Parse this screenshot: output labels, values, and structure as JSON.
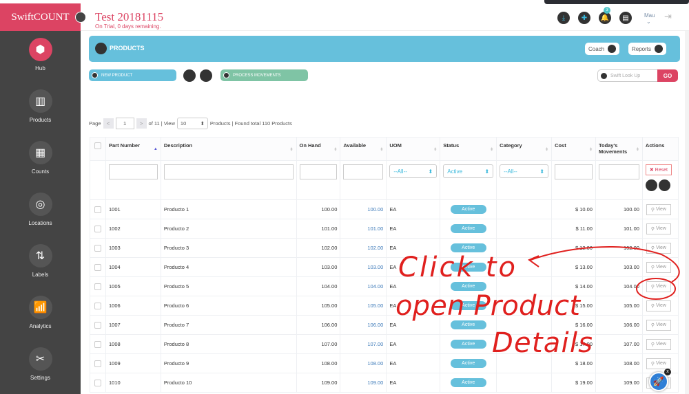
{
  "brand": "SwiftCOUNT",
  "header": {
    "title": "Test 20181115",
    "subtitle": "On Trial, 0 days remaining.",
    "notification_count": "3",
    "user": "Mau"
  },
  "sidebar": [
    {
      "label": "Hub",
      "icon": "hub-icon"
    },
    {
      "label": "Products",
      "icon": "barcode-icon"
    },
    {
      "label": "Counts",
      "icon": "counts-icon"
    },
    {
      "label": "Locations",
      "icon": "location-icon"
    },
    {
      "label": "Labels",
      "icon": "labels-icon"
    },
    {
      "label": "Analytics",
      "icon": "analytics-icon"
    },
    {
      "label": "Settings",
      "icon": "settings-icon"
    }
  ],
  "banner": {
    "title": "PRODUCTS",
    "coach": "Coach",
    "reports": "Reports"
  },
  "toolbar": {
    "new_product": "NEW PRODUCT",
    "process_movements": "PROCESS MOVEMENTS",
    "lookup_placeholder": "Swift Look Up",
    "go": "GO"
  },
  "pager": {
    "page_label": "Page",
    "prev": "<",
    "page": "1",
    "next": ">",
    "of_text": "of 11 | View",
    "per_page": "10",
    "summary": "Products | Found total 110 Products"
  },
  "columns": [
    "Part Number",
    "Description",
    "On Hand",
    "Available",
    "UOM",
    "Status",
    "Category",
    "Cost",
    "Today's Movements",
    "Actions"
  ],
  "filters": {
    "uom": "--All--",
    "status": "Active",
    "category": "--All--",
    "reset": "✖ Reset"
  },
  "rows": [
    [
      "1001",
      "Producto 1",
      "100.00",
      "100.00",
      "EA",
      "Active",
      "",
      "$ 10.00",
      "100.00"
    ],
    [
      "1002",
      "Producto 2",
      "101.00",
      "101.00",
      "EA",
      "Active",
      "",
      "$ 11.00",
      "101.00"
    ],
    [
      "1003",
      "Producto 3",
      "102.00",
      "102.00",
      "EA",
      "Active",
      "",
      "$ 12.00",
      "102.00"
    ],
    [
      "1004",
      "Producto 4",
      "103.00",
      "103.00",
      "EA",
      "Active",
      "",
      "$ 13.00",
      "103.00"
    ],
    [
      "1005",
      "Producto 5",
      "104.00",
      "104.00",
      "EA",
      "Active",
      "",
      "$ 14.00",
      "104.00"
    ],
    [
      "1006",
      "Producto 6",
      "105.00",
      "105.00",
      "EA",
      "Active",
      "",
      "$ 15.00",
      "105.00"
    ],
    [
      "1007",
      "Producto 7",
      "106.00",
      "106.00",
      "EA",
      "Active",
      "",
      "$ 16.00",
      "106.00"
    ],
    [
      "1008",
      "Producto 8",
      "107.00",
      "107.00",
      "EA",
      "Active",
      "",
      "$ 17.00",
      "107.00"
    ],
    [
      "1009",
      "Producto 9",
      "108.00",
      "108.00",
      "EA",
      "Active",
      "",
      "$ 18.00",
      "108.00"
    ],
    [
      "1010",
      "Producto 10",
      "109.00",
      "109.00",
      "EA",
      "Active",
      "",
      "$ 19.00",
      "109.00"
    ]
  ],
  "view_label": "View",
  "annotation": {
    "line1": "Click to",
    "line2": "open Product",
    "line3": "Details"
  },
  "colors": {
    "brand": "#dc4463",
    "banner": "#66c0dc",
    "sidebar": "#444444",
    "annotation": "#e0201e"
  }
}
